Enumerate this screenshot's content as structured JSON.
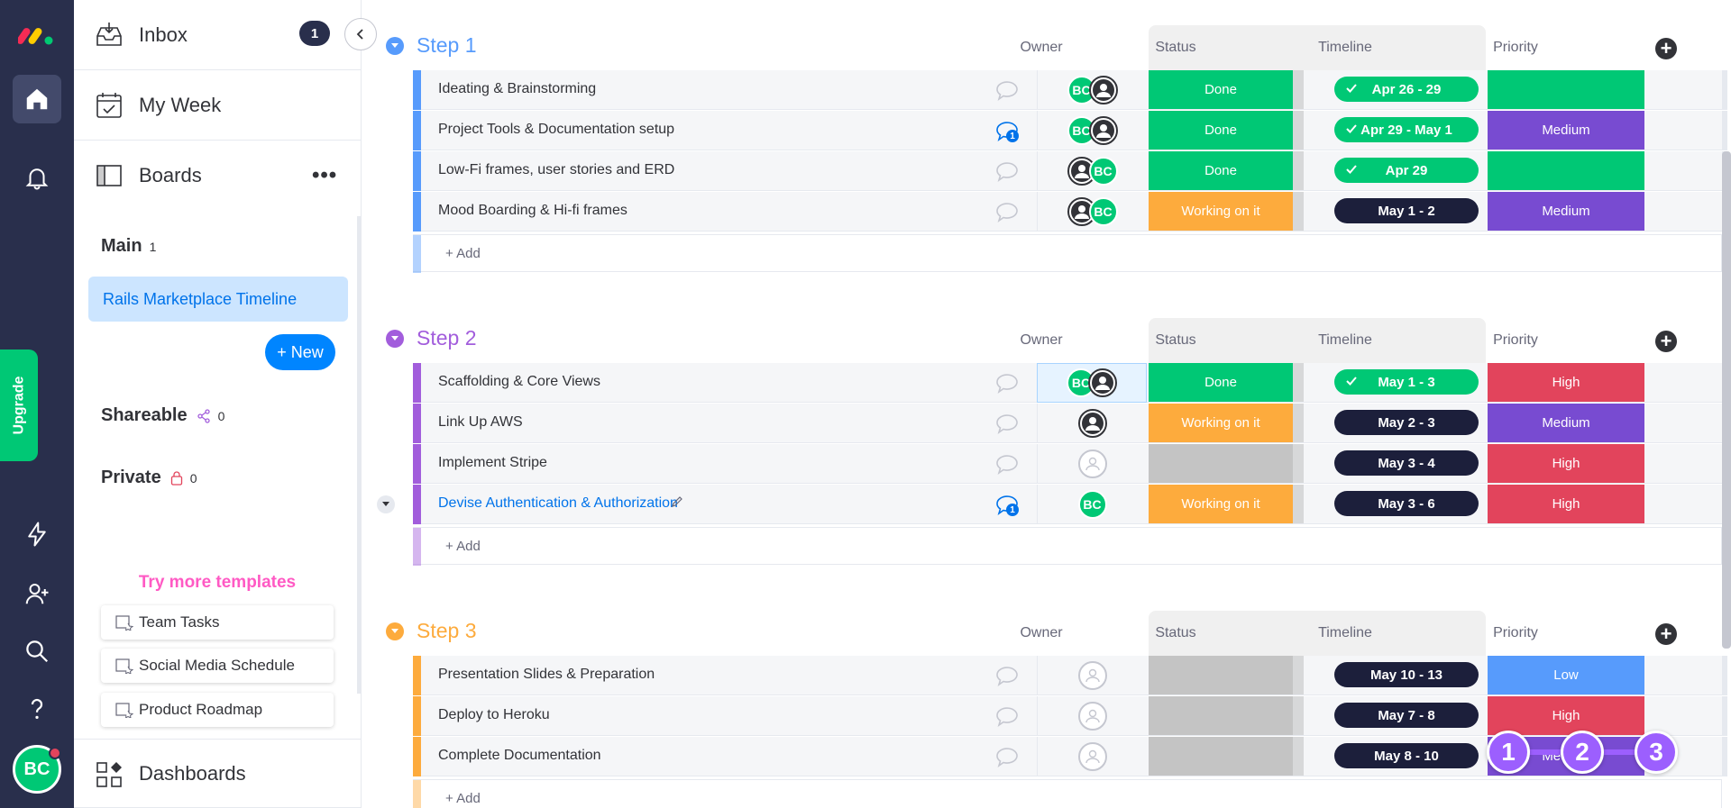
{
  "rail": {
    "upgrade_label": "Upgrade",
    "avatar_initials": "BC"
  },
  "nav": {
    "inbox_label": "Inbox",
    "inbox_count": "1",
    "myweek_label": "My Week",
    "boards_label": "Boards",
    "dashboards_label": "Dashboards"
  },
  "workspace": {
    "main_label": "Main",
    "main_count": "1",
    "board_name": "Rails Marketplace Timeline",
    "new_label": "+ New",
    "shareable_label": "Shareable",
    "shareable_count": "0",
    "private_label": "Private",
    "private_count": "0"
  },
  "templates": {
    "title": "Try more templates",
    "items": [
      "Team Tasks",
      "Social Media Schedule",
      "Product Roadmap"
    ]
  },
  "columns": {
    "owner": "Owner",
    "status": "Status",
    "timeline": "Timeline",
    "priority": "Priority"
  },
  "add_label": "+ Add",
  "colors": {
    "done": "#00c875",
    "working": "#fdab3d",
    "empty": "#c4c4c4",
    "medium": "#784bd1",
    "high": "#e2445c",
    "low": "#579bfc",
    "timeline_dark": "#1c1f3b",
    "group1": "#579bfc",
    "group2": "#a25ddc",
    "group3": "#fdab3d"
  },
  "groups": [
    {
      "title": "Step 1",
      "rows": [
        {
          "name": "Ideating & Brainstorming",
          "status": "Done",
          "timeline": "Apr 26 - 29",
          "priority": "",
          "owners": [
            "BC",
            "photo"
          ],
          "comments": ""
        },
        {
          "name": "Project Tools & Documentation setup",
          "status": "Done",
          "timeline": "Apr 29 - May 1",
          "priority": "Medium",
          "owners": [
            "BC",
            "photo"
          ],
          "comments": "1"
        },
        {
          "name": "Low-Fi frames, user stories and ERD",
          "status": "Done",
          "timeline": "Apr 29",
          "priority": "",
          "owners": [
            "photo",
            "BC"
          ],
          "comments": ""
        },
        {
          "name": "Mood Boarding & Hi-fi frames",
          "status": "Working on it",
          "timeline": "May 1 - 2",
          "priority": "Medium",
          "owners": [
            "photo",
            "BC"
          ],
          "comments": ""
        }
      ]
    },
    {
      "title": "Step 2",
      "rows": [
        {
          "name": "Scaffolding & Core Views",
          "status": "Done",
          "timeline": "May 1 - 3",
          "priority": "High",
          "owners": [
            "BC",
            "photo"
          ],
          "comments": ""
        },
        {
          "name": "Link Up AWS",
          "status": "Working on it",
          "timeline": "May 2 - 3",
          "priority": "Medium",
          "owners": [
            "photo"
          ],
          "comments": ""
        },
        {
          "name": "Implement Stripe",
          "status": "",
          "timeline": "May 3 - 4",
          "priority": "High",
          "owners": [
            "empty"
          ],
          "comments": ""
        },
        {
          "name": "Devise Authentication & Authorization",
          "status": "Working on it",
          "timeline": "May 3 - 6",
          "priority": "High",
          "owners": [
            "BC"
          ],
          "comments": "1"
        }
      ]
    },
    {
      "title": "Step 3",
      "rows": [
        {
          "name": "Presentation Slides & Preparation",
          "status": "",
          "timeline": "May 10 - 13",
          "priority": "Low",
          "owners": [
            "empty"
          ],
          "comments": ""
        },
        {
          "name": "Deploy to Heroku",
          "status": "",
          "timeline": "May 7 - 8",
          "priority": "High",
          "owners": [
            "empty"
          ],
          "comments": ""
        },
        {
          "name": "Complete Documentation",
          "status": "",
          "timeline": "May 8 - 10",
          "priority": "Medium",
          "owners": [
            "empty"
          ],
          "comments": ""
        }
      ]
    }
  ],
  "overlay_steps": [
    "1",
    "2",
    "3"
  ]
}
